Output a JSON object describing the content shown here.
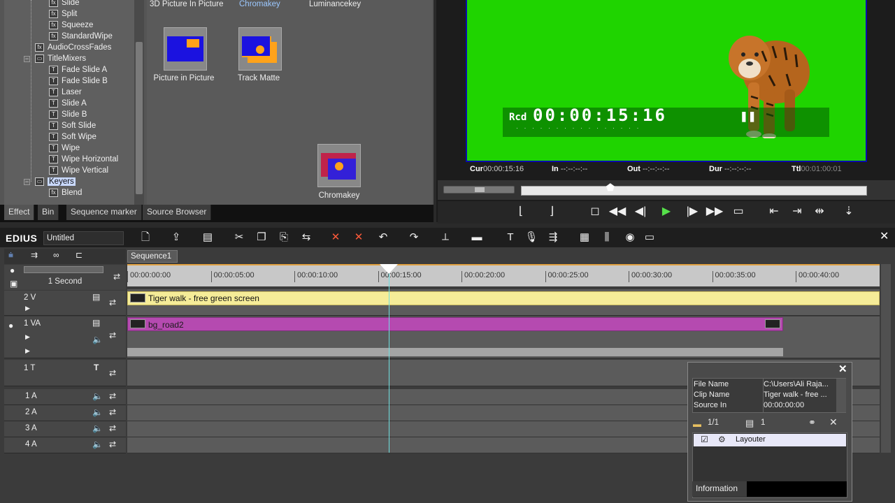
{
  "effect_tree": {
    "items": [
      {
        "label": "Slide",
        "indent": 2,
        "icon": "fx"
      },
      {
        "label": "Split",
        "indent": 2,
        "icon": "fx"
      },
      {
        "label": "Squeeze",
        "indent": 2,
        "icon": "fx"
      },
      {
        "label": "StandardWipe",
        "indent": 2,
        "icon": "fx"
      },
      {
        "label": "AudioCrossFades",
        "indent": 1,
        "icon": "fx"
      },
      {
        "label": "TitleMixers",
        "indent": 1,
        "icon": "folder"
      },
      {
        "label": "Fade Slide A",
        "indent": 2,
        "icon": "T"
      },
      {
        "label": "Fade Slide B",
        "indent": 2,
        "icon": "T"
      },
      {
        "label": "Laser",
        "indent": 2,
        "icon": "T"
      },
      {
        "label": "Slide A",
        "indent": 2,
        "icon": "T"
      },
      {
        "label": "Slide B",
        "indent": 2,
        "icon": "T"
      },
      {
        "label": "Soft Slide",
        "indent": 2,
        "icon": "T"
      },
      {
        "label": "Soft Wipe",
        "indent": 2,
        "icon": "T"
      },
      {
        "label": "Wipe",
        "indent": 2,
        "icon": "T"
      },
      {
        "label": "Wipe Horizontal",
        "indent": 2,
        "icon": "T"
      },
      {
        "label": "Wipe Vertical",
        "indent": 2,
        "icon": "T"
      },
      {
        "label": "Keyers",
        "indent": 1,
        "icon": "folder"
      },
      {
        "label": "Blend",
        "indent": 2,
        "icon": "fx"
      }
    ]
  },
  "effect_grid": {
    "top_labels": [
      "3D Picture In Picture",
      "Chromakey",
      "Luminancekey"
    ],
    "items": [
      {
        "label": "Picture in Picture"
      },
      {
        "label": "Track Matte"
      },
      {
        "label": "Chromakey"
      }
    ]
  },
  "effect_tabs": [
    "Effect",
    "Bin",
    "Sequence marker",
    "Source Browser"
  ],
  "preview": {
    "rcd": "Rcd",
    "timecode": "00:00:15:16",
    "cur_label": "Cur",
    "cur_value": "00:00:15:16",
    "in_label": "In",
    "in_value": "--:--:--:--",
    "out_label": "Out",
    "out_value": "--:--:--:--",
    "dur_label": "Dur",
    "dur_value": "--:--:--:--",
    "ttl_label": "Ttl",
    "ttl_value": "00:01:00:01",
    "scrub_position": 0.26
  },
  "toolbar": {
    "app_name": "EDIUS",
    "project_name": "Untitled"
  },
  "timeline": {
    "sequence_tab": "Sequence1",
    "zoom": "1 Second",
    "ruler_ticks": [
      "00:00:00:00",
      "00:00:05:00",
      "00:00:10:00",
      "00:00:15:00",
      "00:00:20:00",
      "00:00:25:00",
      "00:00:30:00",
      "00:00:35:00",
      "00:00:40:00"
    ],
    "tracks": [
      {
        "name": "2 V"
      },
      {
        "name": "1 VA"
      },
      {
        "name": "1 T"
      },
      {
        "name": "1 A"
      },
      {
        "name": "2 A"
      },
      {
        "name": "3 A"
      },
      {
        "name": "4 A"
      }
    ],
    "clips": {
      "tiger": "Tiger walk -  free green screen",
      "road": "bg_road2"
    }
  },
  "info_panel": {
    "rows": [
      {
        "key": "File Name",
        "value": "C:\\Users\\Ali Raja..."
      },
      {
        "key": "Clip Name",
        "value": "Tiger walk -  free ..."
      },
      {
        "key": "Source In",
        "value": "00:00:00:00"
      }
    ],
    "page": "1/1",
    "count": "1",
    "filter": "Layouter",
    "tab": "Information"
  },
  "colors": {
    "green_screen": "#1fd400",
    "tiger_clip": "#f5ec98",
    "road_clip": "#b54ab0",
    "playhead": "#6fe0e0"
  }
}
